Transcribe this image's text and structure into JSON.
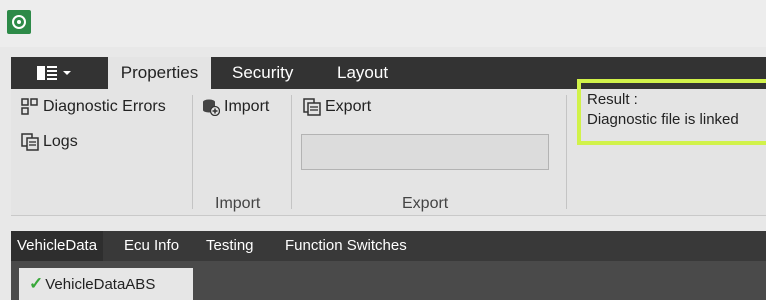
{
  "ribbon": {
    "tabs": [
      {
        "label": "Properties"
      },
      {
        "label": "Security"
      },
      {
        "label": "Layout"
      }
    ],
    "buttons": {
      "diagnostic_errors": "Diagnostic Errors",
      "logs": "Logs",
      "import": "Import",
      "export": "Export"
    },
    "groups": {
      "import": "Import",
      "export": "Export"
    },
    "export_input_value": ""
  },
  "result": {
    "label": "Result :",
    "message": "Diagnostic file is linked"
  },
  "doc_tabs": [
    {
      "label": "VehicleData"
    },
    {
      "label": "Ecu Info"
    },
    {
      "label": "Testing"
    },
    {
      "label": "Function Switches"
    }
  ],
  "subtabs": [
    {
      "label": "VehicleDataABS",
      "status": "ok"
    }
  ],
  "colors": {
    "highlight": "#d1f24a",
    "check": "#39a83a",
    "dark_bar": "#333333"
  },
  "icons": [
    "app-logo-icon",
    "app-menu-icon",
    "diagnostic-errors-icon",
    "logs-icon",
    "import-icon",
    "export-icon",
    "check-icon"
  ]
}
